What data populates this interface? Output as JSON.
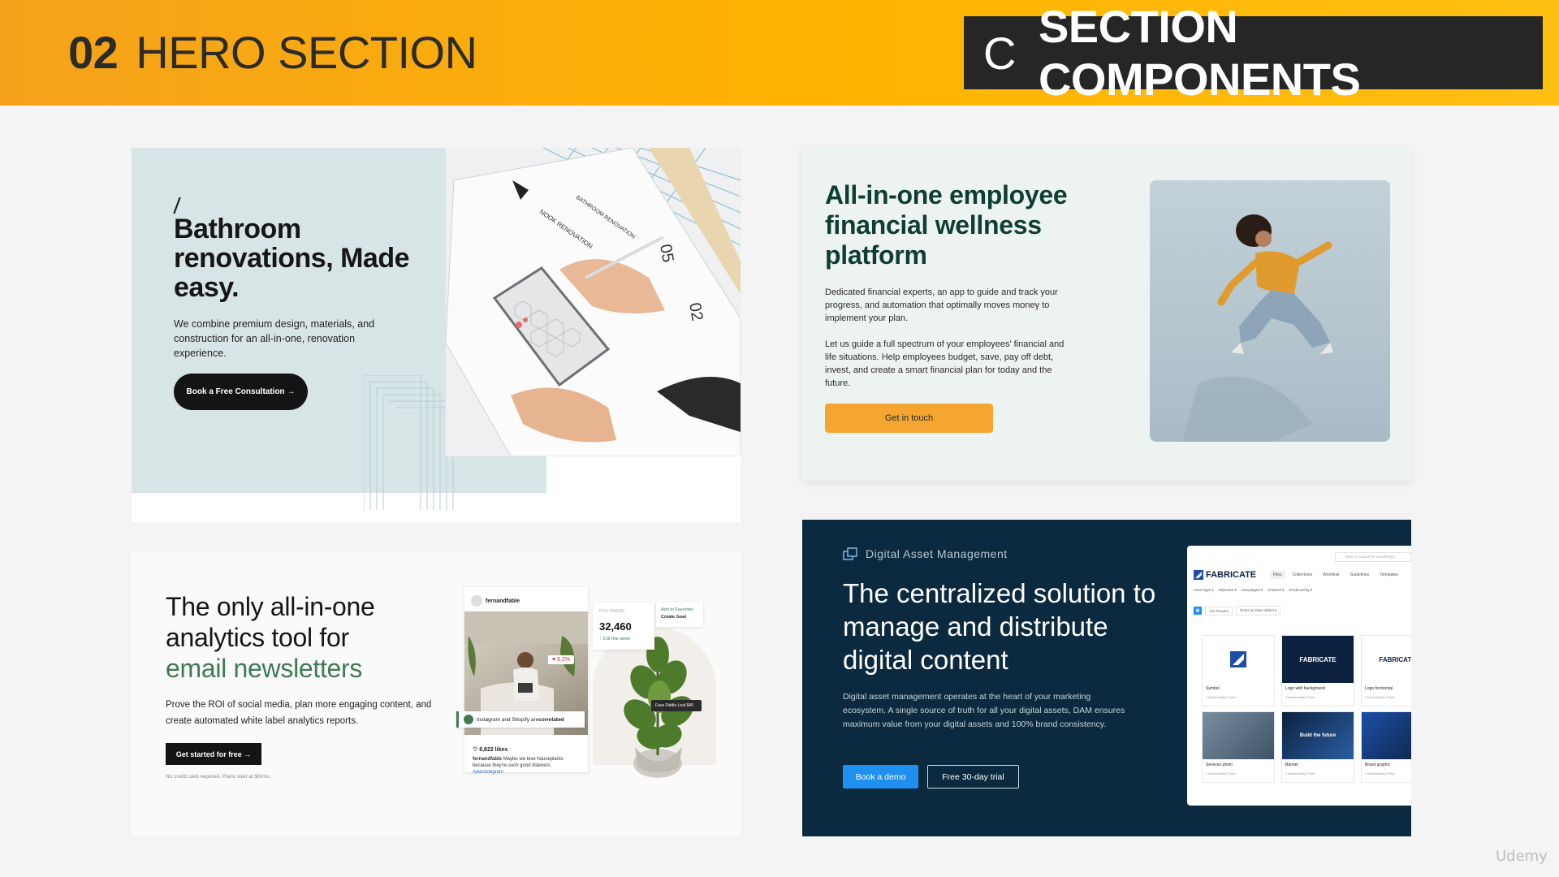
{
  "banner": {
    "section_number": "02",
    "section_title": "HERO SECTION",
    "category_letter": "C",
    "category_title": "SECTION COMPONENTS",
    "gradient_start": "#f4a21b",
    "gradient_end": "#ffbe12"
  },
  "bathroom": {
    "heading": "Bathroom renovations, Made easy.",
    "body": "We combine premium design, materials, and construction for an all-in-one, renovation experience.",
    "cta": "Book a Free Consultation →",
    "bg_color": "#d8e5e7",
    "photo_texts": [
      "NOOK RENOVATION",
      "BATHROOM RENOVATION",
      "05",
      "02"
    ]
  },
  "wellness": {
    "heading": "All-in-one employee financial wellness platform",
    "para1": "Dedicated financial experts, an app to guide and track your progress, and automation that optimally moves money to implement your plan.",
    "para2": "Let us guide a full spectrum of your employees' financial and life situations. Help employees budget, save, pay off debt, invest, and create a smart financial plan for today and the future.",
    "cta": "Get in touch",
    "heading_color": "#0f3d33",
    "cta_color": "#f6a531"
  },
  "analytics": {
    "heading_line1": "The only all-in-one",
    "heading_line2": "analytics tool for",
    "heading_accent": "email newsletters",
    "body": "Prove the ROI of social media, plan more engaging content, and create automated white label analytics reports.",
    "cta": "Get started for free →",
    "note": "No credit card required. Plans start at $0/mo.",
    "accent_color": "#3e7b55",
    "post": {
      "username": "fernandfable",
      "badge": "♥ 6.2%",
      "likes": "♡ 6,822 likes",
      "caption_user": "fernandfable",
      "caption": "Maybe we love houseplants because they're such good listeners.",
      "hashtag": "#plantstagram"
    },
    "tag_prefix": "Instagram and Shopify are ",
    "tag_emphasis": "correlated",
    "followers": {
      "label": "FOLLOWERS",
      "value": "32,460",
      "change": "↑ 218 this week"
    },
    "favorites": {
      "label": "Add to Favorites",
      "goal": "Create Goal"
    },
    "leaf_tag": "Faux Fiddle Leaf $45"
  },
  "dam": {
    "kicker": "Digital Asset Management",
    "heading": "The centralized solution to manage and distribute digital content",
    "body": "Digital asset management operates at the heart of your marketing ecosystem. A single source of truth for all your digital assets, DAM ensures maximum value from your digital assets and 100% brand consistency.",
    "cta_primary": "Book a demo",
    "cta_secondary": "Free 30-day trial",
    "bg_color": "#0c2a3f",
    "button_color": "#1f8ff0",
    "app": {
      "search_placeholder": "Want to search for something?",
      "brand": "FABRICATE",
      "tabs": [
        "Files",
        "Collections",
        "Workflow",
        "Guidelines",
        "Templates"
      ],
      "filters": [
        "Asset type ▾",
        "Objective ▾",
        "Campaigns ▾",
        "Channel ▾",
        "Produced by ▾"
      ],
      "result_count": "132 Results",
      "sort": "Order by Date added ▾",
      "tiles": [
        {
          "name": "Symbol",
          "meta": "Confidentiality Public"
        },
        {
          "name": "Logo with background",
          "meta": "Confidentiality Public"
        },
        {
          "name": "Logo horizontal",
          "meta": "Confidentiality Public"
        },
        {
          "name": "Services photo",
          "meta": "Confidentiality Public"
        },
        {
          "name": "Banner",
          "meta": "Confidentiality Public"
        },
        {
          "name": "Brand graphic",
          "meta": "Confidentiality Public"
        }
      ],
      "tile_brand": "FABRICATE",
      "banner_text": "Build the future"
    }
  },
  "watermark": "Udemy"
}
